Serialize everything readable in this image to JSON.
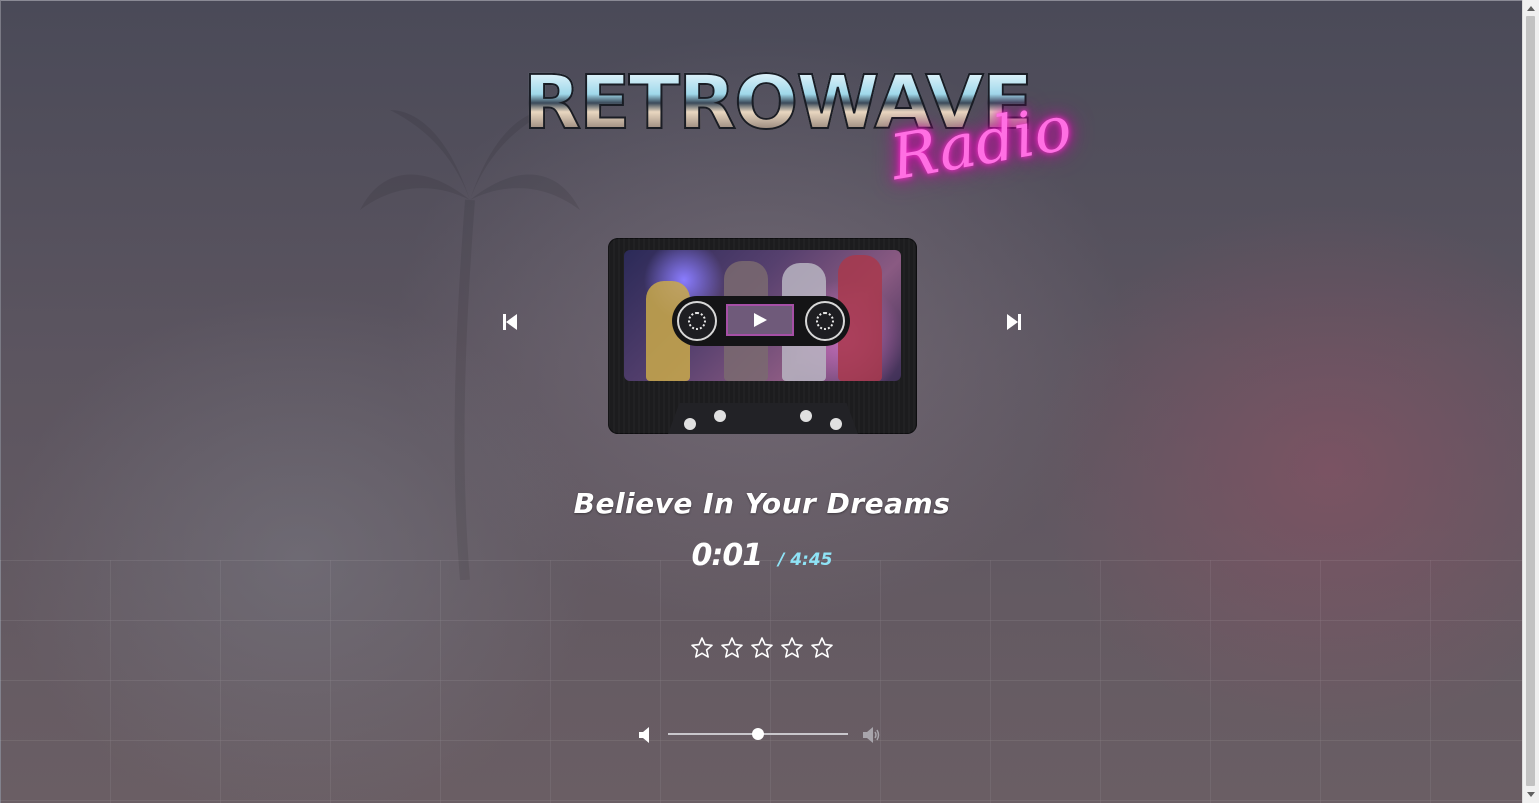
{
  "logo": {
    "word": "RETROWAVE",
    "script": "Radio"
  },
  "player": {
    "track_title": "Believe In Your Dreams",
    "current_time": "0:01",
    "total_time": "/ 4:45",
    "prev_icon": "skip-previous-icon",
    "next_icon": "skip-next-icon",
    "play_icon": "play-icon"
  },
  "rating": {
    "max": 5,
    "value": 0
  },
  "volume": {
    "level": 0.5,
    "low_icon": "volume-low-icon",
    "high_icon": "volume-high-icon"
  },
  "colors": {
    "accent_pink": "#ff4fd8",
    "time_accent": "#8fe3f6",
    "play_window_border": "#a64fa6"
  }
}
